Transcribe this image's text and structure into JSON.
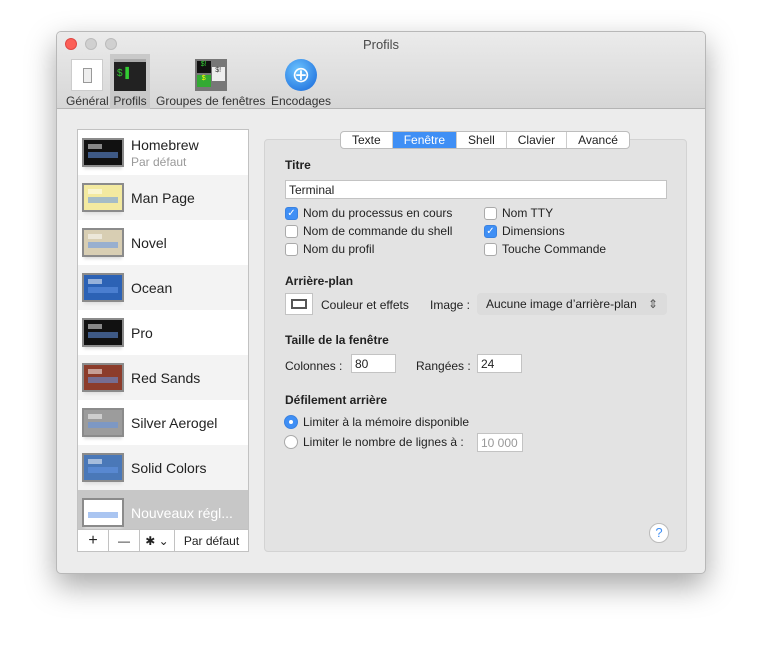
{
  "window": {
    "title": "Profils"
  },
  "toolbar": [
    {
      "label": "Général",
      "icon": "general-switch-icon"
    },
    {
      "label": "Profils",
      "icon": "terminal-profile-icon",
      "selected": true
    },
    {
      "label": "Groupes de fenêtres",
      "icon": "window-groups-icon"
    },
    {
      "label": "Encodages",
      "icon": "globe-icon"
    }
  ],
  "profiles": [
    {
      "name": "Homebrew",
      "subtitle": "Par défaut",
      "color": "#111111"
    },
    {
      "name": "Man Page",
      "color": "#f3eaa0"
    },
    {
      "name": "Novel",
      "color": "#d8ceb3"
    },
    {
      "name": "Ocean",
      "color": "#2c62b5"
    },
    {
      "name": "Pro",
      "color": "#111111"
    },
    {
      "name": "Red Sands",
      "color": "#8c3c2b"
    },
    {
      "name": "Silver Aerogel",
      "color": "#9c9c9c"
    },
    {
      "name": "Solid Colors",
      "color": "#4a78b8"
    },
    {
      "name": "Nouveaux régl...",
      "color": "#ffffff",
      "selected": true
    }
  ],
  "list_buttons": {
    "add": "+",
    "remove": "—",
    "gear": "✱ ⌄",
    "default": "Par défaut"
  },
  "tabs": [
    {
      "label": "Texte"
    },
    {
      "label": "Fenêtre",
      "active": true
    },
    {
      "label": "Shell"
    },
    {
      "label": "Clavier"
    },
    {
      "label": "Avancé"
    }
  ],
  "titre": {
    "heading": "Titre",
    "value": "Terminal",
    "options": [
      {
        "label": "Nom du processus en cours",
        "checked": true
      },
      {
        "label": "Nom de commande du shell",
        "checked": false
      },
      {
        "label": "Nom du profil",
        "checked": false
      },
      {
        "label": "Nom TTY",
        "checked": false
      },
      {
        "label": "Dimensions",
        "checked": true
      },
      {
        "label": "Touche Commande",
        "checked": false
      }
    ]
  },
  "background": {
    "heading": "Arrière-plan",
    "color_label": "Couleur et effets",
    "image_label": "Image :",
    "image_value": "Aucune image d’arrière-plan"
  },
  "size": {
    "heading": "Taille de la fenêtre",
    "cols_label": "Colonnes :",
    "cols": "80",
    "rows_label": "Rangées :",
    "rows": "24"
  },
  "scrollback": {
    "heading": "Défilement arrière",
    "opt1": "Limiter à la mémoire disponible",
    "opt2": "Limiter le nombre de lignes à :",
    "lines": "10 000",
    "selected": "opt1"
  },
  "help": "?",
  "accent": "#3f8ff5"
}
